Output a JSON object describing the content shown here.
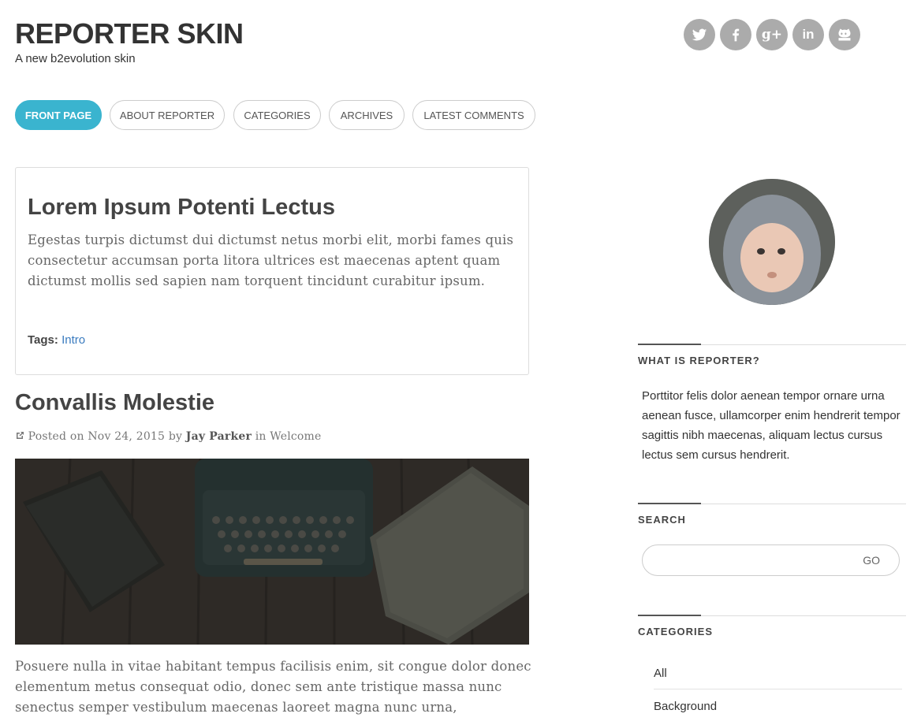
{
  "header": {
    "site_title": "REPORTER SKIN",
    "tagline": "A new b2evolution skin"
  },
  "social": [
    {
      "icon": "twitter-icon"
    },
    {
      "icon": "facebook-icon"
    },
    {
      "icon": "google-plus-icon",
      "label": "g+"
    },
    {
      "icon": "linkedin-icon",
      "label": "in"
    },
    {
      "icon": "github-icon"
    }
  ],
  "nav": {
    "items": [
      {
        "label": "FRONT PAGE",
        "active": true
      },
      {
        "label": "ABOUT REPORTER"
      },
      {
        "label": "CATEGORIES"
      },
      {
        "label": "ARCHIVES"
      },
      {
        "label": "LATEST COMMENTS"
      }
    ]
  },
  "posts": [
    {
      "title": "Lorem Ipsum Potenti Lectus",
      "excerpt": "Egestas turpis dictumst dui dictumst netus morbi elit, morbi fames quis consectetur accumsan porta litora ultrices est maecenas aptent quam dictumst mollis sed sapien nam torquent tincidunt curabitur ipsum.",
      "tags_label": "Tags:",
      "tag": "Intro"
    },
    {
      "title": "Convallis Molestie",
      "meta_prefix": "Posted on",
      "date": "Nov 24, 2015",
      "by": "by",
      "author": "Jay Parker",
      "in": "in",
      "category": "Welcome",
      "excerpt": "Posuere nulla in vitae habitant tempus facilisis enim, sit congue dolor donec elementum metus consequat odio, donec sem ante tristique massa nunc senectus semper vestibulum maecenas laoreet magna nunc urna,"
    }
  ],
  "sidebar": {
    "about": {
      "title": "WHAT IS REPORTER?",
      "text": "Porttitor felis dolor aenean tempor ornare urna aenean fusce, ullamcorper enim hendrerit tempor sagittis nibh maecenas, aliquam lectus cursus lectus sem cursus hendrerit."
    },
    "search": {
      "title": "SEARCH",
      "placeholder": "",
      "button": "GO"
    },
    "categories": {
      "title": "CATEGORIES",
      "items": [
        "All",
        "Background"
      ]
    }
  },
  "colors": {
    "accent": "#3ab4cf",
    "social_bg": "#ababab",
    "link": "#3a7bbf"
  }
}
